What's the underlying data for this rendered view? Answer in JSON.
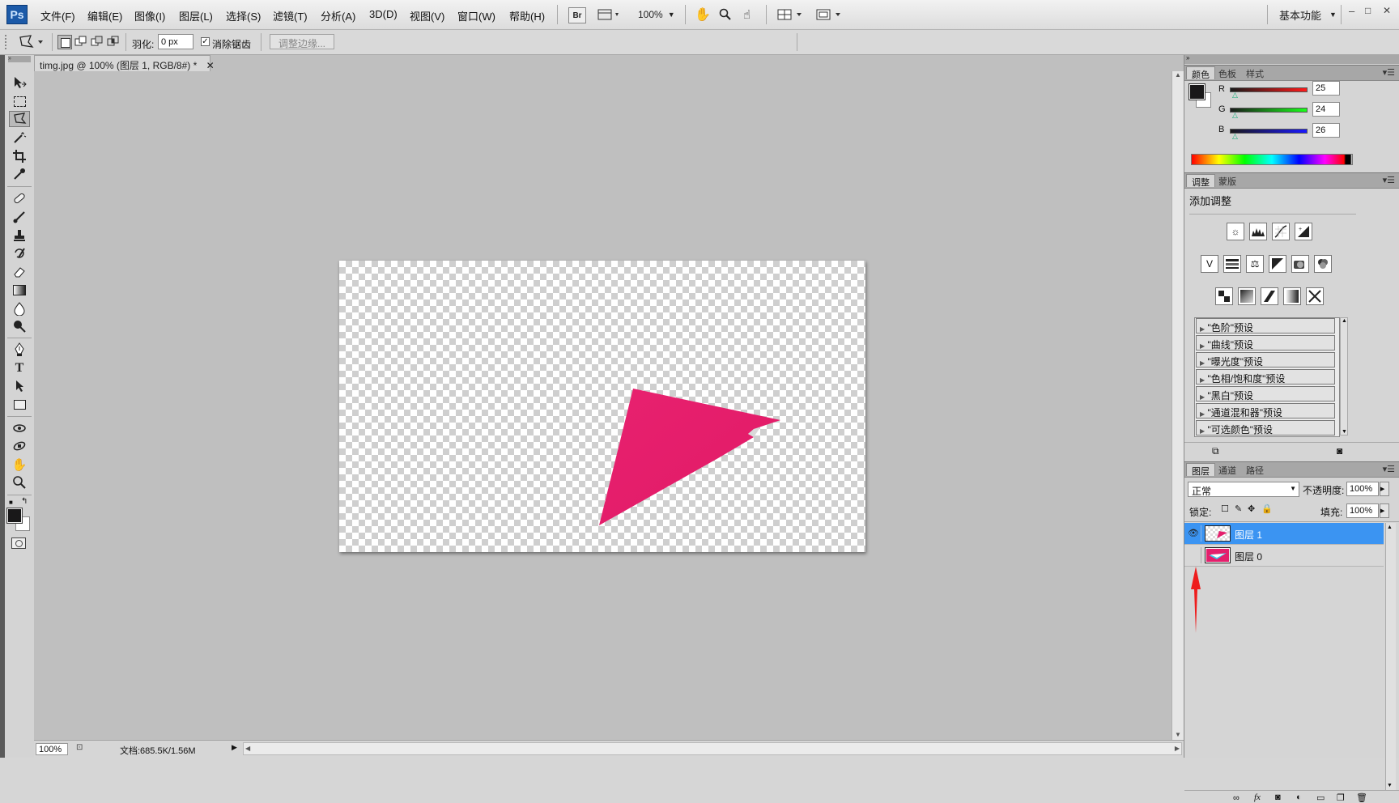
{
  "app": {
    "logo": "Ps",
    "menu": [
      "文件(F)",
      "编辑(E)",
      "图像(I)",
      "图层(L)",
      "选择(S)",
      "滤镜(T)",
      "分析(A)",
      "3D(D)",
      "视图(V)",
      "窗口(W)",
      "帮助(H)"
    ],
    "bridge_label": "Br",
    "zoom_label": "100%",
    "workspace_label": "基本功能",
    "window_controls": [
      "–",
      "□",
      "✕"
    ]
  },
  "options": {
    "feather_label": "羽化:",
    "feather_value": "0 px",
    "antialias_label": "消除锯齿",
    "antialias_checked": true,
    "refine_edge_label": "调整边缘..."
  },
  "document": {
    "tab_title": "timg.jpg @ 100% (图层 1, RGB/8#) *",
    "tab_close": "✕",
    "shape_color": "#e41f6c"
  },
  "status": {
    "zoom": "100%",
    "doc_info": "文档:685.5K/1.56M"
  },
  "color_panel": {
    "tabs": [
      "颜色",
      "色板",
      "样式"
    ],
    "channels": [
      {
        "label": "R",
        "value": "25",
        "color": "#d11"
      },
      {
        "label": "G",
        "value": "24",
        "color": "#1a1"
      },
      {
        "label": "B",
        "value": "26",
        "color": "#11c"
      }
    ],
    "foreground": "#191819",
    "background": "#ffffff"
  },
  "adjust_panel": {
    "tabs": [
      "调整",
      "蒙版"
    ],
    "title": "添加调整",
    "presets": [
      "\"色阶\"预设",
      "\"曲线\"预设",
      "\"曝光度\"预设",
      "\"色相/饱和度\"预设",
      "\"黑白\"预设",
      "\"通道混和器\"预设",
      "\"可选颜色\"预设"
    ]
  },
  "layers_panel": {
    "tabs": [
      "图层",
      "通道",
      "路径"
    ],
    "blend_mode": "正常",
    "opacity_label": "不透明度:",
    "opacity_value": "100%",
    "lock_label": "锁定:",
    "fill_label": "填充:",
    "fill_value": "100%",
    "layers": [
      {
        "name": "图层 1",
        "visible": true,
        "selected": true
      },
      {
        "name": "图层 0",
        "visible": false,
        "selected": false
      }
    ]
  }
}
